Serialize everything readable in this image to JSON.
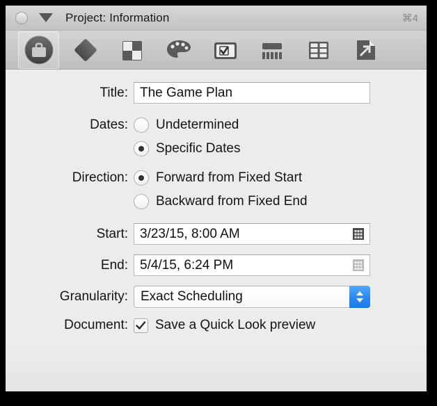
{
  "window": {
    "title": "Project: Information",
    "shortcut": "⌘4",
    "close_icon": "close-button",
    "disclosure_icon": "disclosure-triangle-icon"
  },
  "toolbar": {
    "items": [
      {
        "name": "briefcase-icon",
        "label": "Project",
        "selected": true
      },
      {
        "name": "diamond-icon",
        "label": "Milestone",
        "selected": false
      },
      {
        "name": "checkerboard-icon",
        "label": "Task",
        "selected": false
      },
      {
        "name": "palette-icon",
        "label": "Style",
        "selected": false
      },
      {
        "name": "checkbox-box-icon",
        "label": "Completion",
        "selected": false
      },
      {
        "name": "calendar-bars-icon",
        "label": "Schedule",
        "selected": false
      },
      {
        "name": "grid-table-icon",
        "label": "Table",
        "selected": false
      },
      {
        "name": "document-arrow-icon",
        "label": "Document",
        "selected": false
      }
    ]
  },
  "form": {
    "title_label": "Title:",
    "title_value": "The Game Plan",
    "title_placeholder": "",
    "dates_label": "Dates:",
    "dates_options": [
      {
        "label": "Undetermined",
        "selected": false
      },
      {
        "label": "Specific Dates",
        "selected": true
      }
    ],
    "direction_label": "Direction:",
    "direction_options": [
      {
        "label": "Forward from Fixed Start",
        "selected": true
      },
      {
        "label": "Backward from Fixed End",
        "selected": false
      }
    ],
    "start_label": "Start:",
    "start_value": "3/23/15, 8:00 AM",
    "start_icon": "calendar-picker-icon",
    "end_label": "End:",
    "end_value": "5/4/15, 6:24 PM",
    "end_icon": "calendar-picker-icon",
    "granularity_label": "Granularity:",
    "granularity_value": "Exact Scheduling",
    "granularity_stepper_icon": "popup-updown-arrows-icon",
    "document_label": "Document:",
    "document_checkbox_label": "Save a Quick Look preview",
    "document_checked": true
  },
  "colors": {
    "accent_blue": "#2d8bf0",
    "window_bg": "#ececec",
    "titlebar_bg": "#cccccc",
    "toolbar_bg": "#c8c8c8",
    "text": "#141414",
    "shortcut_text": "#888888"
  }
}
